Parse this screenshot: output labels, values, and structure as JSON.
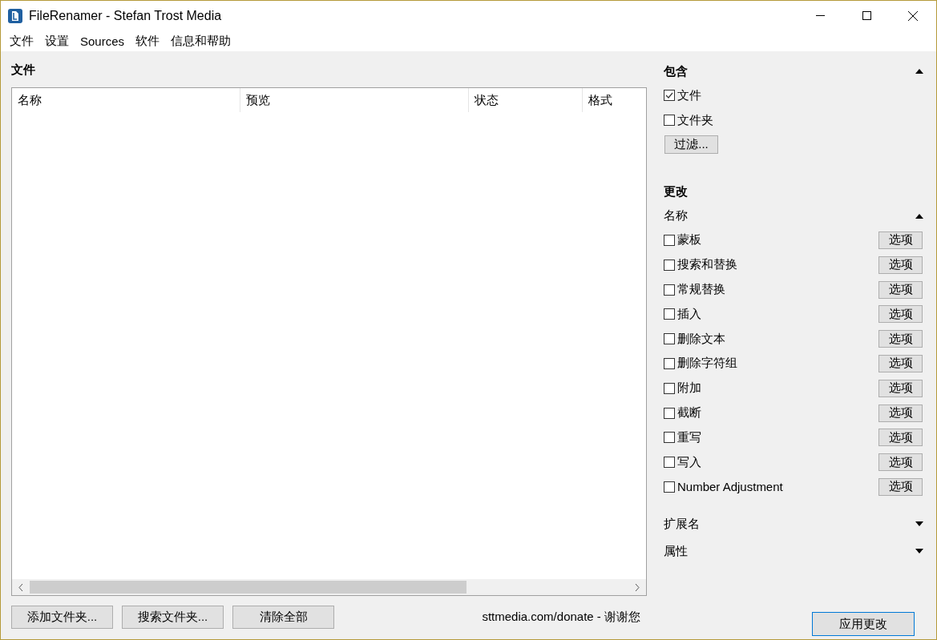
{
  "window": {
    "title": "FileRenamer - Stefan Trost Media"
  },
  "menu": [
    "文件",
    "设置",
    "Sources",
    "软件",
    "信息和帮助"
  ],
  "files": {
    "title": "文件",
    "columns": [
      "名称",
      "预览",
      "状态",
      "格式"
    ]
  },
  "include": {
    "title": "包含",
    "expanded": true,
    "options": [
      {
        "label": "文件",
        "checked": true
      },
      {
        "label": "文件夹",
        "checked": false
      }
    ],
    "filter_button": "过滤..."
  },
  "change": {
    "title": "更改",
    "groups": [
      {
        "title": "名称",
        "expanded": true,
        "items": [
          {
            "label": "蒙板",
            "checked": false,
            "button": "选项"
          },
          {
            "label": "搜索和替换",
            "checked": false,
            "button": "选项"
          },
          {
            "label": "常规替换",
            "checked": false,
            "button": "选项"
          },
          {
            "label": "插入",
            "checked": false,
            "button": "选项"
          },
          {
            "label": "删除文本",
            "checked": false,
            "button": "选项"
          },
          {
            "label": "删除字符组",
            "checked": false,
            "button": "选项"
          },
          {
            "label": "附加",
            "checked": false,
            "button": "选项"
          },
          {
            "label": "截断",
            "checked": false,
            "button": "选项"
          },
          {
            "label": "重写",
            "checked": false,
            "button": "选项"
          },
          {
            "label": "写入",
            "checked": false,
            "button": "选项"
          },
          {
            "label": "Number Adjustment",
            "checked": false,
            "button": "选项"
          }
        ]
      },
      {
        "title": "扩展名",
        "expanded": false
      },
      {
        "title": "属性",
        "expanded": false
      }
    ]
  },
  "footer": {
    "buttons": [
      "添加文件夹...",
      "搜索文件夹...",
      "清除全部"
    ],
    "donate": "sttmedia.com/donate - 谢谢您",
    "apply_button": "应用更改"
  }
}
